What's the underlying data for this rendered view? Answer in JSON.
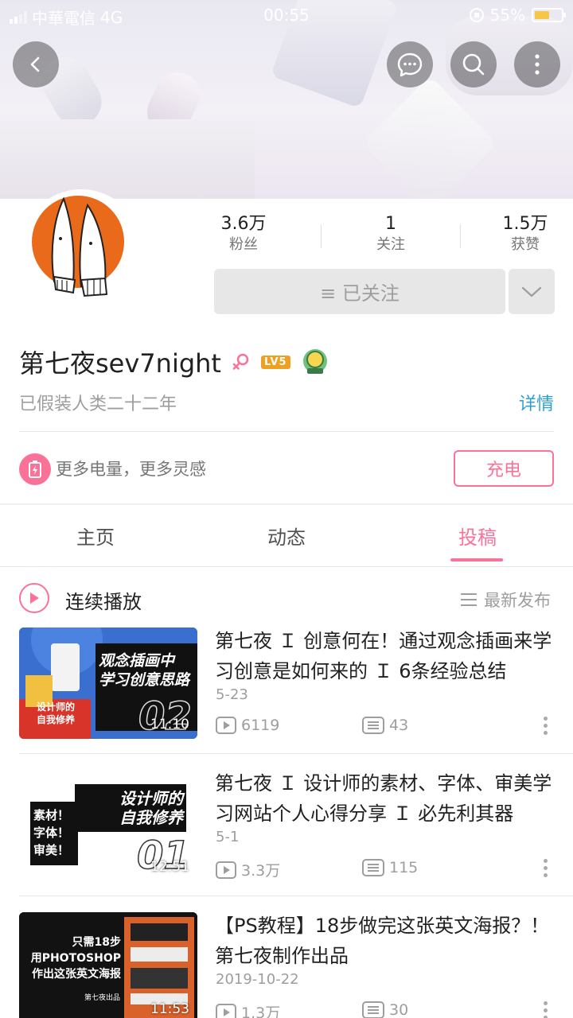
{
  "status_bar": {
    "carrier": "中華電信",
    "network": "4G",
    "time": "00:55",
    "battery_percent": "55%",
    "battery_level": 0.55
  },
  "profile": {
    "followers_count": "3.6万",
    "followers_label": "粉丝",
    "following_count": "1",
    "following_label": "关注",
    "likes_count": "1.5万",
    "likes_label": "获赞",
    "follow_state_label": "≡ 已关注",
    "username": "第七夜sev7night",
    "level_badge": "LV5",
    "bio": "已假装人类二十二年",
    "detail_link": "详情"
  },
  "charge": {
    "text": "更多电量，更多灵感",
    "button": "充电"
  },
  "tabs": [
    {
      "label": "主页",
      "active": false
    },
    {
      "label": "动态",
      "active": false
    },
    {
      "label": "投稿",
      "active": true
    }
  ],
  "playlist": {
    "continuous_play": "连续播放",
    "sort_label": "最新发布"
  },
  "videos": [
    {
      "title": "第七夜 Ｉ 创意何在！通过观念插画来学习创意是如何来的 Ｉ 6条经验总结",
      "date": "5-23",
      "duration": "11:10",
      "views": "6119",
      "comments": "43",
      "thumb_big_text": "观念插画中\n学习创意思路",
      "thumb_small_text": "设计师的\n自我修养",
      "thumb_number": "02"
    },
    {
      "title": "第七夜 Ｉ 设计师的素材、字体、审美学习网站个人心得分享 Ｉ 必先利其器",
      "date": "5-1",
      "duration": "12:51",
      "views": "3.3万",
      "comments": "115",
      "thumb_big_text": "设计师的\n自我修养",
      "thumb_small_text": "素材！\n字体！\n审美！",
      "thumb_number": "01"
    },
    {
      "title": "【PS教程】18步做完这张英文海报？！第七夜制作出品",
      "date": "2019-10-22",
      "duration": "11:53",
      "views": "1.3万",
      "comments": "30",
      "thumb_big_text": "只需18步\n用PHOTOSHOP\n作出这张英文海报",
      "thumb_small_text": "第七夜出品",
      "thumb_number": ""
    }
  ],
  "colors": {
    "accent_pink": "#fb7299",
    "link_blue": "#2e9fd1",
    "battery_yellow": "#f6c64b"
  },
  "icons": [
    "back-arrow-icon",
    "message-icon",
    "search-icon",
    "more-vertical-icon",
    "chevron-down-icon",
    "female-icon",
    "play-icon",
    "sort-icon",
    "views-icon",
    "comments-icon",
    "battery-charge-icon"
  ]
}
